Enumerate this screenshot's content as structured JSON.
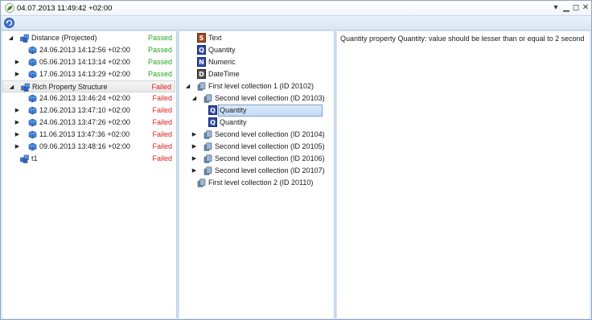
{
  "window": {
    "title": "04.07.2013 11:49:42 +02:00"
  },
  "left_tree": [
    {
      "label": "Distance (Projected)",
      "status": "Passed",
      "level": 0,
      "expander": "expanded",
      "icon": "cube-group-icon"
    },
    {
      "label": "24.06.2013 14:12:56 +02:00",
      "status": "Passed",
      "level": 1,
      "expander": "none",
      "icon": "cube-icon"
    },
    {
      "label": "05.06.2013 14:13:14 +02:00",
      "status": "Passed",
      "level": 1,
      "expander": "collapsed",
      "icon": "cube-icon"
    },
    {
      "label": "17.06.2013 14:13:29 +02:00",
      "status": "Passed",
      "level": 1,
      "expander": "collapsed",
      "icon": "cube-icon"
    },
    {
      "label": "Rich Property Structure",
      "status": "Failed",
      "level": 0,
      "expander": "expanded",
      "icon": "cube-group-icon"
    },
    {
      "label": "24.06.2013 13:46:24 +02:00",
      "status": "Failed",
      "level": 1,
      "expander": "none",
      "icon": "cube-icon"
    },
    {
      "label": "12.06.2013 13:47:10 +02:00",
      "status": "Failed",
      "level": 1,
      "expander": "collapsed",
      "icon": "cube-icon"
    },
    {
      "label": "24.06.2013 13:47:26 +02:00",
      "status": "Failed",
      "level": 1,
      "expander": "collapsed",
      "icon": "cube-icon"
    },
    {
      "label": "11.06.2013 13:47:36 +02:00",
      "status": "Failed",
      "level": 1,
      "expander": "collapsed",
      "icon": "cube-icon"
    },
    {
      "label": "09.06.2013 13:48:16 +02:00",
      "status": "Failed",
      "level": 1,
      "expander": "collapsed",
      "icon": "cube-icon"
    },
    {
      "label": "t1",
      "status": "Failed",
      "level": 0,
      "expander": "none",
      "icon": "cube-group-icon"
    }
  ],
  "middle_tree": [
    {
      "label": "Text",
      "badge": "S",
      "type": "string"
    },
    {
      "label": "Quantity",
      "badge": "Q",
      "type": "quantity"
    },
    {
      "label": "Numeric",
      "badge": "N",
      "type": "numeric"
    },
    {
      "label": "DateTime",
      "badge": "D",
      "type": "datetime"
    },
    {
      "label": "First level collection 1 (ID 20102)",
      "badge": "",
      "type": "collection"
    },
    {
      "label": "Second level collection (ID 20103)",
      "badge": "",
      "type": "collection"
    },
    {
      "label": "Quantity",
      "badge": "Q",
      "type": "quantity",
      "selected": true
    },
    {
      "label": "Quantity",
      "badge": "Q",
      "type": "quantity"
    },
    {
      "label": "Second level collection (ID 20104)",
      "badge": "",
      "type": "collection"
    },
    {
      "label": "Second level collection (ID 20105)",
      "badge": "",
      "type": "collection"
    },
    {
      "label": "Second level collection (ID 20106)",
      "badge": "",
      "type": "collection"
    },
    {
      "label": "Second level collection (ID 20107)",
      "badge": "",
      "type": "collection"
    },
    {
      "label": "First level collection 2 (ID 20110)",
      "badge": "",
      "type": "collection"
    }
  ],
  "detail": {
    "message": "Quantity property Quantity: value should be lesser than or equal to 2 second"
  },
  "colors": {
    "passed": "#28a428",
    "failed": "#e02020",
    "selection": "#c3dcf7"
  }
}
